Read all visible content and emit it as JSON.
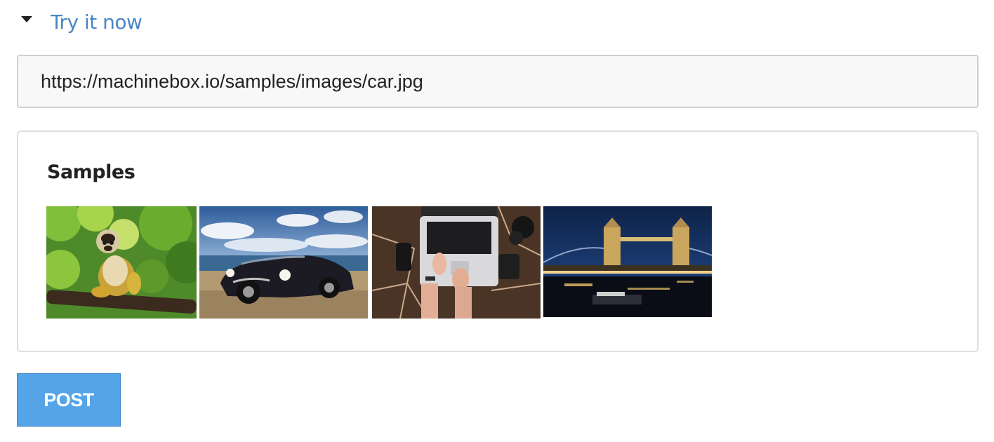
{
  "try_it": {
    "label": "Try it now",
    "expanded": true,
    "link_color": "#4a86c4"
  },
  "url_field": {
    "value": "https://machinebox.io/samples/images/car.jpg"
  },
  "samples": {
    "title": "Samples",
    "items": [
      {
        "name": "monkey-sample",
        "subject": "squirrel monkey on branch"
      },
      {
        "name": "car-sample",
        "subject": "vintage convertible car"
      },
      {
        "name": "laptop-sample",
        "subject": "hands typing on laptop"
      },
      {
        "name": "bridge-sample",
        "subject": "tower bridge at night"
      }
    ]
  },
  "post_button": {
    "label": "POST",
    "color": "#55a4e8"
  }
}
